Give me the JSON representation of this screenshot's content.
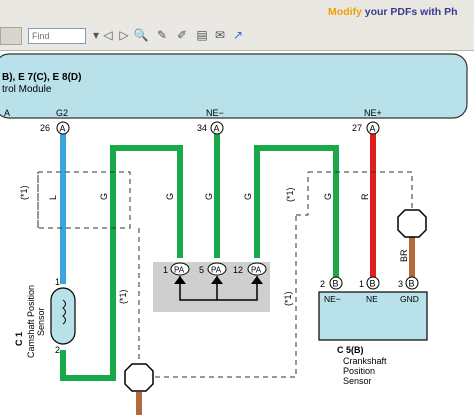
{
  "app": {
    "banner_prefix": "Modify",
    "banner_suffix": "your PDFs with Ph",
    "find_placeholder": "Find",
    "icons": [
      "dropdown-arrow",
      "find-previous-icon",
      "find-next-icon",
      "search-icon",
      "edit-icon",
      "pencil-icon",
      "comment-icon",
      "note-icon",
      "arrow-icon"
    ]
  },
  "diagram": {
    "header": {
      "title": "B), E 7(C), E 8(D)",
      "subtitle": "trol Module"
    },
    "ecm_pins": [
      {
        "name": "A",
        "number": "",
        "connector": ""
      },
      {
        "name": "G2",
        "number": "26",
        "connector": "A"
      },
      {
        "name": "NE−",
        "number": "34",
        "connector": "A"
      },
      {
        "name": "NE+",
        "number": "27",
        "connector": "A"
      }
    ],
    "wire_colors": {
      "G2": "L",
      "left_g": "G",
      "pa_left": "G",
      "pa_mid": "G",
      "pa_right": "G",
      "ne_minus": "G",
      "ne_plus": "R",
      "ground": "BR"
    },
    "shield_label": "(*1)",
    "splice": [
      {
        "num": "1",
        "conn": "PA"
      },
      {
        "num": "5",
        "conn": "PA"
      },
      {
        "num": "12",
        "conn": "PA"
      }
    ],
    "camshaft": {
      "code": "C 1",
      "name": "Camshaft Position",
      "name2": "Sensor",
      "pin_top": "1",
      "pin_bottom": "2"
    },
    "crankshaft": {
      "pins": [
        {
          "num": "2",
          "conn": "B",
          "label": "NE−"
        },
        {
          "num": "1",
          "conn": "B",
          "label": "NE"
        },
        {
          "num": "3",
          "conn": "B",
          "label": "GND"
        }
      ],
      "code": "C 5(B)",
      "name_line1": "Crankshaft",
      "name_line2": "Position",
      "name_line3": "Sensor"
    },
    "colors": {
      "ecm_fill": "#b9e1ea",
      "wire_blue": "#3aa6dc",
      "wire_green": "#19a84a",
      "wire_red": "#e02020",
      "wire_brown": "#b5683c",
      "sensor_fill": "#b9e1ea",
      "splice_fill": "#cfcfcf"
    }
  }
}
